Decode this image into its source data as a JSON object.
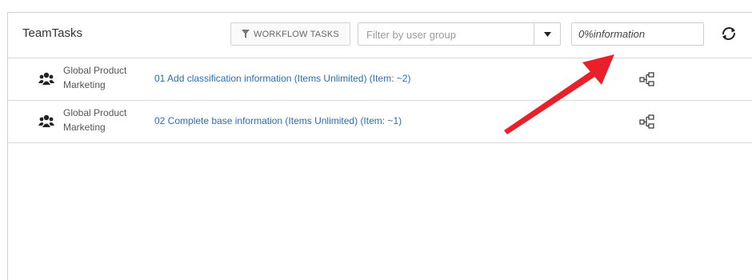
{
  "header": {
    "title": "TeamTasks",
    "workflow_button_label": "WORKFLOW TASKS",
    "group_filter_placeholder": "Filter by user group",
    "search_value": "0%information"
  },
  "rows": [
    {
      "group_name": "Global Product Marketing",
      "task_label": "01 Add classification information (Items Unlimited) (Item: ~2)"
    },
    {
      "group_name": "Global Product Marketing",
      "task_label": "02 Complete base information (Items Unlimited) (Item: ~1)"
    }
  ],
  "icons": {
    "filter": "funnel-icon",
    "dropdown": "caret-down-icon",
    "refresh": "refresh-icon",
    "group": "users-group-icon",
    "workflow": "workflow-diagram-icon"
  },
  "colors": {
    "link": "#2a6ebb",
    "annotation_arrow": "#e8202a"
  }
}
